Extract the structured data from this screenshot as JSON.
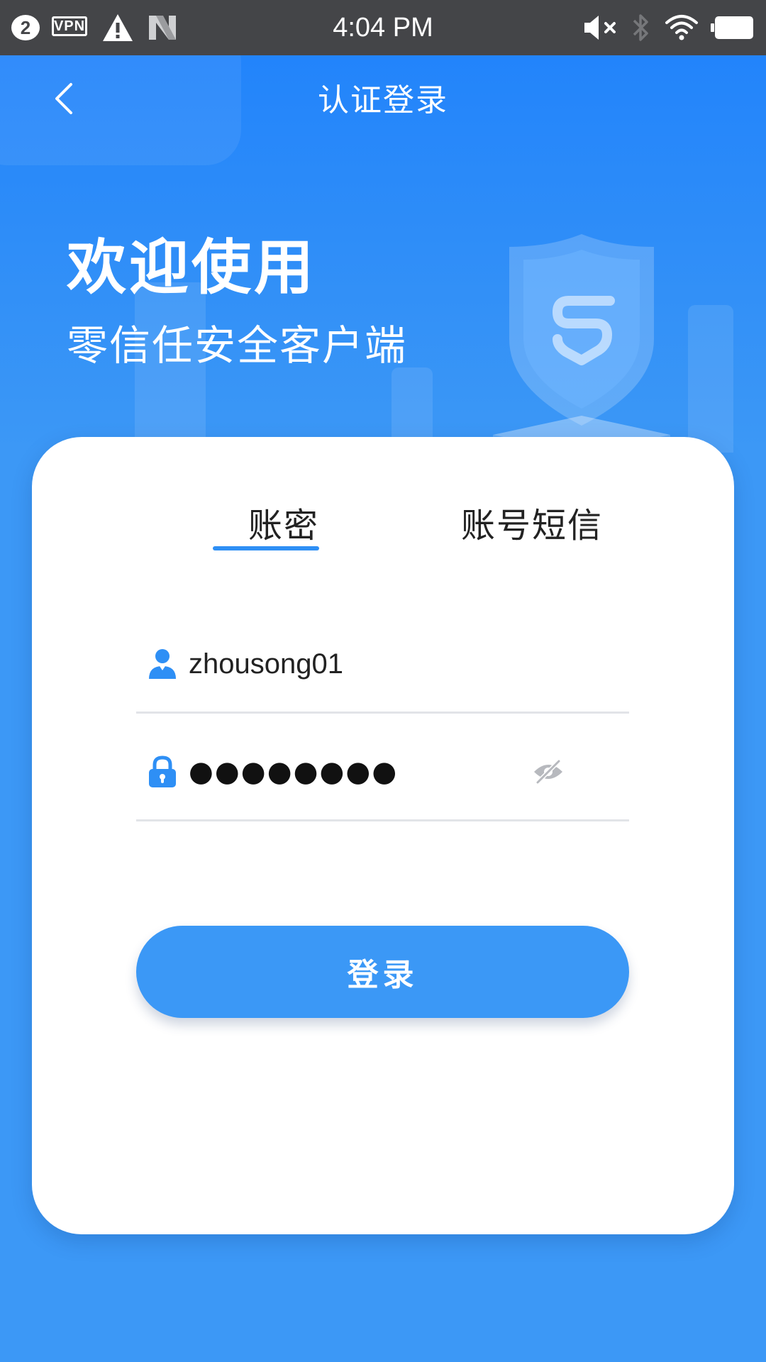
{
  "status_bar": {
    "notification_count": "2",
    "vpn_label": "VPN",
    "time": "4:04 PM",
    "icons": [
      "notification-count-icon",
      "vpn-icon",
      "warning-icon",
      "n-app-icon",
      "mute-icon",
      "bluetooth-icon",
      "wifi-icon",
      "battery-icon"
    ]
  },
  "header": {
    "title": "认证登录",
    "back_icon": "chevron-left-icon"
  },
  "hero": {
    "title": "欢迎使用",
    "subtitle": "零信任安全客户端",
    "illustration_icon": "shield-s-icon"
  },
  "login": {
    "tabs": [
      {
        "label": "账密",
        "active": true
      },
      {
        "label": "账号短信",
        "active": false
      }
    ],
    "username": {
      "value": "zhousong01",
      "icon": "user-icon"
    },
    "password": {
      "value": "●●●●●●●●",
      "icon": "lock-icon",
      "toggle_icon": "eye-hidden-icon"
    },
    "submit_label": "登录"
  },
  "colors": {
    "primary": "#3b98f6",
    "header_blue": "#2284fb",
    "status_bar": "#444548",
    "tab_indicator": "#2e8ff5"
  }
}
